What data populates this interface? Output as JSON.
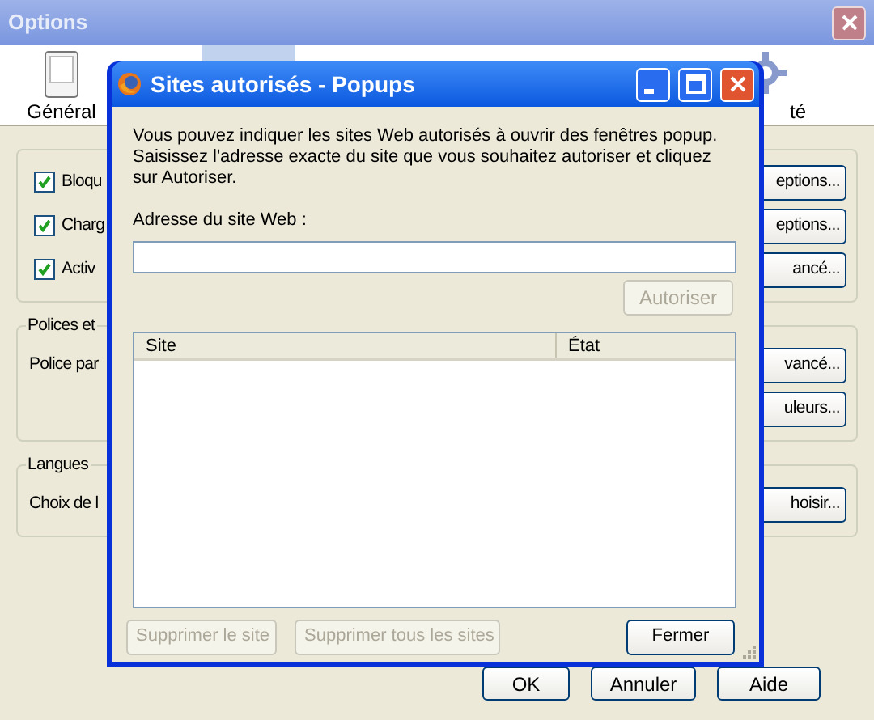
{
  "window": {
    "title": "Options"
  },
  "toolbar": [
    {
      "label": "Général",
      "selected": false
    },
    {
      "selected": true
    },
    {
      "label": "té",
      "selected": false
    }
  ],
  "groups": [
    {
      "rows": [
        {
          "kind": "checkbox",
          "label": "Bloqu",
          "checked": true,
          "button": "eptions..."
        },
        {
          "kind": "checkbox",
          "label": "Charg",
          "checked": true,
          "button": "eptions..."
        },
        {
          "kind": "checkbox",
          "label": "Activ",
          "checked": true,
          "button": "ancé..."
        }
      ]
    },
    {
      "legend": "Polices et",
      "rows": [
        {
          "kind": "text",
          "label": "Police par",
          "button": "vancé..."
        },
        {
          "kind": "text",
          "button": "uleurs..."
        }
      ]
    },
    {
      "legend": "Langues",
      "rows": [
        {
          "kind": "text",
          "label": "Choix de l",
          "button": "hoisir..."
        }
      ]
    }
  ],
  "buttons": [
    "OK",
    "Annuler",
    "Aide"
  ],
  "dialog": {
    "title": "Sites autorisés - Popups",
    "description": "Vous pouvez indiquer les sites Web autorisés à ouvrir des fenêtres popup. Saisissez l'adresse exacte du site que vous souhaitez autoriser et cliquez sur Autoriser.",
    "address_label": "Adresse du site Web :",
    "allow_button": {
      "label": "Autoriser",
      "disabled": true
    },
    "columns": [
      "Site",
      "État"
    ],
    "buttons": [
      {
        "label": "Supprimer le site",
        "disabled": true
      },
      {
        "label": "Supprimer tous les sites",
        "disabled": true
      },
      {
        "label": "Fermer",
        "disabled": false
      }
    ]
  }
}
